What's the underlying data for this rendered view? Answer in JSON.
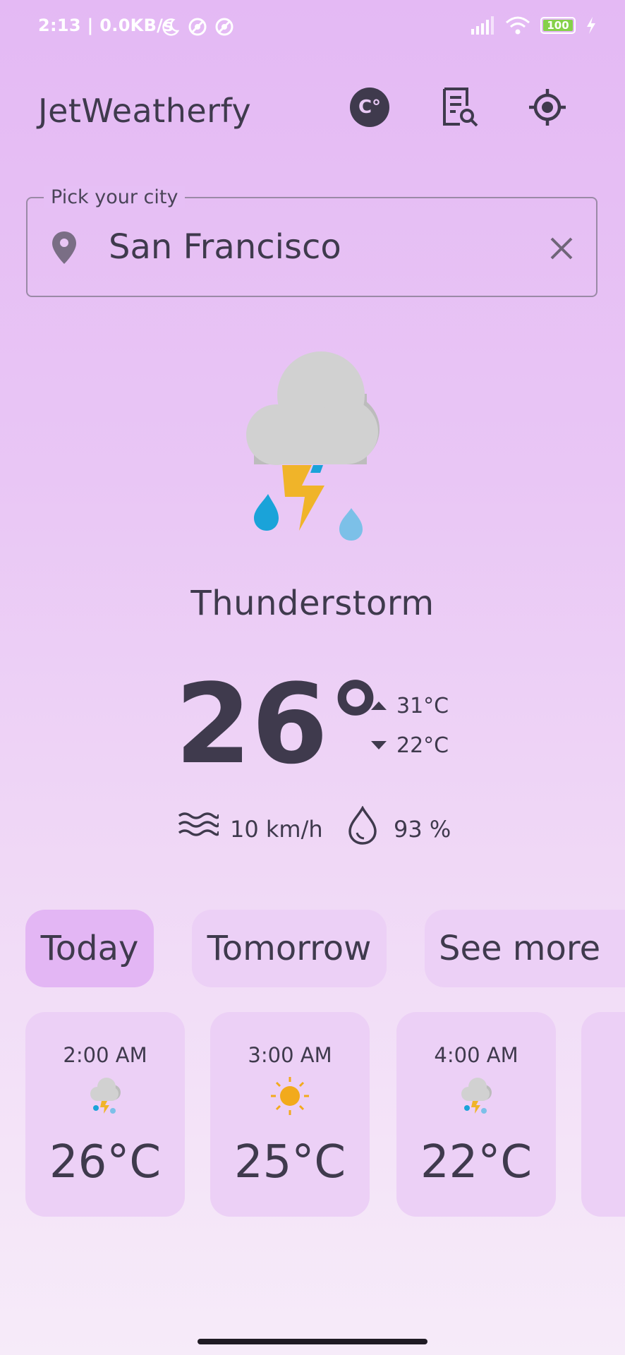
{
  "status_bar": {
    "time": "2:13 | 0.0KB/s",
    "battery": "100"
  },
  "header": {
    "title": "JetWeatherfy",
    "unit_label": "C°"
  },
  "city_field": {
    "label": "Pick your city",
    "value": "San Francisco"
  },
  "current": {
    "icon": "thunderstorm-icon",
    "condition": "Thunderstorm",
    "temperature": "26°",
    "high": "31°C",
    "low": "22°C",
    "wind": "10 km/h",
    "humidity": "93 %"
  },
  "tabs": [
    {
      "label": "Today",
      "selected": true
    },
    {
      "label": "Tomorrow",
      "selected": false
    },
    {
      "label": "See more",
      "selected": false
    }
  ],
  "hourly": [
    {
      "time": "2:00 AM",
      "icon": "thunderstorm-icon",
      "temp": "26°C"
    },
    {
      "time": "3:00 AM",
      "icon": "sun-icon",
      "temp": "25°C"
    },
    {
      "time": "4:00 AM",
      "icon": "thunderstorm-icon",
      "temp": "22°C"
    }
  ],
  "colors": {
    "text": "#3f3a4d",
    "selected_tab": "#e3b6f4",
    "card": "#ecd0f6",
    "rain_drop": "#1aa3d9",
    "bolt": "#f0b429",
    "sun": "#f2aa1c"
  }
}
